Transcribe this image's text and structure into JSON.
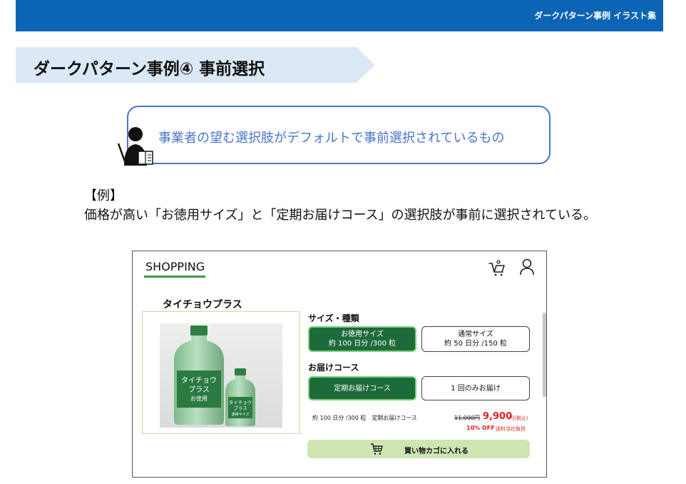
{
  "header": {
    "title": "ダークパターン事例 イラスト集"
  },
  "section": {
    "heading": "ダークパターン事例④ 事前選択"
  },
  "definition": {
    "text": "事業者の望む選択肢がデフォルトで事前選択されているもの"
  },
  "example": {
    "label": "【例】",
    "text": "価格が高い「お徳用サイズ」と「定期お届けコース」の選択肢が事前に選択されている。"
  },
  "shop": {
    "logo": "SHOPPING",
    "product_name": "タイチョウプラス",
    "image": {
      "big_label": [
        "タイチョウ",
        "プラス",
        "お徳用"
      ],
      "small_label": [
        "タイチョウ",
        "プラス",
        "通常サイズ"
      ]
    },
    "size_section": {
      "label": "サイズ・種類",
      "options": [
        {
          "line1": "お徳用サイズ",
          "line2": "約 100 日分 /300 粒",
          "selected": true
        },
        {
          "line1": "通常サイズ",
          "line2": "約 50 日分 /150 粒",
          "selected": false
        }
      ]
    },
    "delivery_section": {
      "label": "お届けコース",
      "options": [
        {
          "line1": "定期お届けコース",
          "selected": true
        },
        {
          "line1": "1 回のみお届け",
          "selected": false
        }
      ]
    },
    "summary": "約 100 日分 /300 粒　定期お届けコース",
    "old_price": "11,000円",
    "price": "9,900",
    "price_unit": "円(税込)",
    "discount": "10% OFF",
    "shipping": "送料当社負担",
    "add_to_cart": "買い物カゴに入れる"
  },
  "colors": {
    "brand_blue": "#0b64b5",
    "selected_green": "#1e6b3a",
    "cart_green": "#cfe5b4",
    "price_red": "#dd2222"
  }
}
